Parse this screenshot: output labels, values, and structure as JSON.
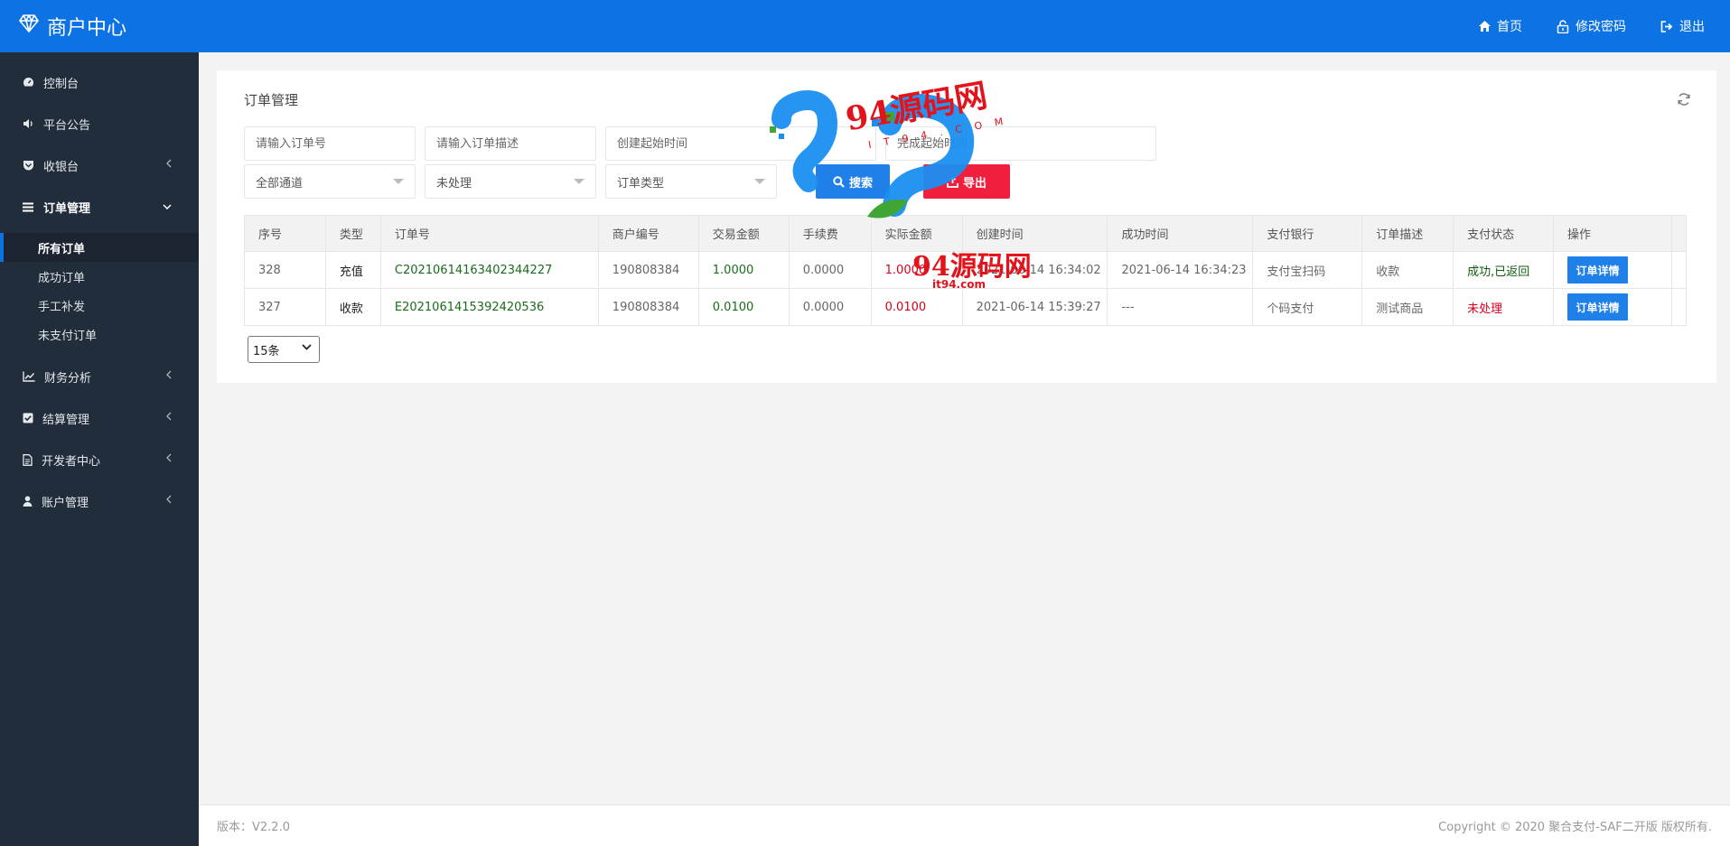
{
  "brand": {
    "title": "商户中心",
    "icon": "diamond-icon"
  },
  "topnav": [
    {
      "label": "首页",
      "icon": "home-icon"
    },
    {
      "label": "修改密码",
      "icon": "lock-icon"
    },
    {
      "label": "退出",
      "icon": "logout-icon"
    }
  ],
  "sidebar": {
    "items": [
      {
        "label": "控制台",
        "icon": "dashboard-icon"
      },
      {
        "label": "平台公告",
        "icon": "volume-icon"
      },
      {
        "label": "收银台",
        "icon": "shield-icon"
      },
      {
        "label": "订单管理",
        "icon": "list-icon"
      },
      {
        "label": "财务分析",
        "icon": "chart-icon"
      },
      {
        "label": "结算管理",
        "icon": "check-square-icon"
      },
      {
        "label": "开发者中心",
        "icon": "file-icon"
      },
      {
        "label": "账户管理",
        "icon": "user-icon"
      }
    ],
    "sub_items": [
      "所有订单",
      "成功订单",
      "手工补发",
      "未支付订单"
    ]
  },
  "page": {
    "title": "订单管理",
    "filters": {
      "order_no_placeholder": "请输入订单号",
      "order_desc_placeholder": "请输入订单描述",
      "create_time_placeholder": "创建起始时间",
      "complete_time_placeholder": "完成起始时间",
      "channel": "全部通道",
      "status": "未处理",
      "order_type": "订单类型"
    },
    "buttons": {
      "search": "搜索",
      "export": "导出"
    }
  },
  "table": {
    "headers": [
      "序号",
      "类型",
      "订单号",
      "商户编号",
      "交易金额",
      "手续费",
      "实际金额",
      "创建时间",
      "成功时间",
      "支付银行",
      "订单描述",
      "支付状态",
      "操作"
    ],
    "rows": [
      {
        "id": "328",
        "type": "充值",
        "order_no": "C20210614163402344227",
        "merchant": "190808384",
        "amount": "1.0000",
        "fee": "0.0000",
        "actual": "1.0000",
        "created": "2021-06-14 16:34:02",
        "success": "2021-06-14 16:34:23",
        "bank": "支付宝扫码",
        "desc": "收款",
        "status": "成功,已返回",
        "action": "订单详情"
      },
      {
        "id": "327",
        "type": "收款",
        "order_no": "E20210614153924205​36",
        "merchant": "190808384",
        "amount": "0.0100",
        "fee": "0.0000",
        "actual": "0.0100",
        "created": "2021-06-14 15:39:27",
        "success": "---",
        "bank": "个码支付",
        "desc": "测试商品",
        "status": "未处理",
        "action": "订单详情"
      }
    ]
  },
  "pager": {
    "page_size": "15条"
  },
  "footer": {
    "version": "版本：V2.2.0",
    "copyright": "Copyright © 2020 聚合支付-SAF二开版 版权所有."
  },
  "watermark": {
    "text1": "94源码网",
    "text2": "IT94.COM",
    "text3": "94源码网",
    "text4": "it94.com"
  },
  "colors": {
    "topbar": "#0d72e4",
    "sidebar": "#222d3c",
    "primary": "#1e80e8",
    "danger": "#f01f3e"
  }
}
